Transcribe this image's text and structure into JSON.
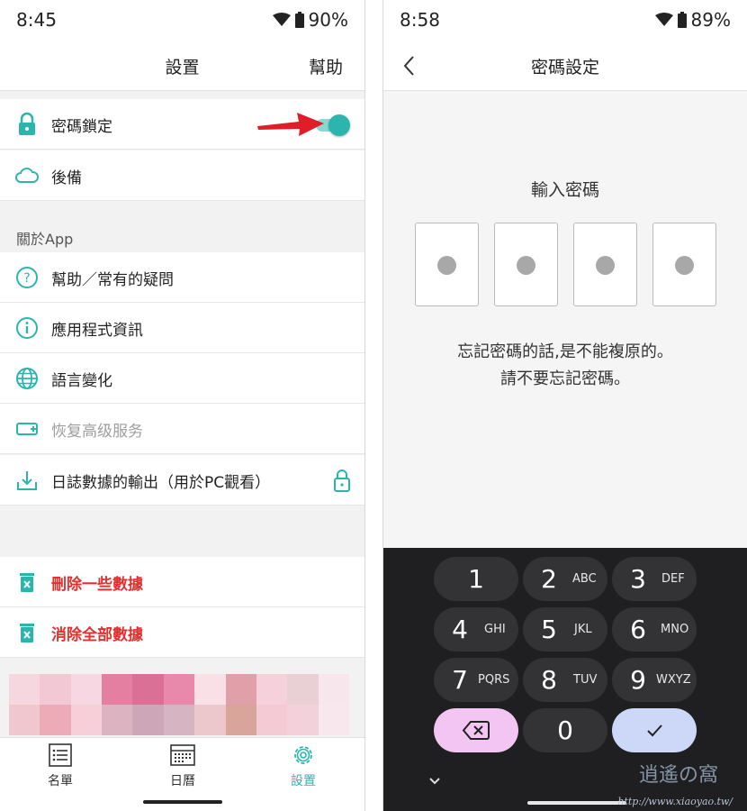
{
  "left": {
    "status": {
      "time": "8:45",
      "battery": "90%"
    },
    "header": {
      "title": "設置",
      "help": "幫助"
    },
    "rows": {
      "password_lock": "密碼鎖定",
      "backup": "後備",
      "about_section": "關於App",
      "help_faq": "幫助／常有的疑問",
      "app_info": "應用程式資訊",
      "language": "語言變化",
      "restore_premium": "恢复高级服务",
      "export_log": "日誌數據的輸出（用於PC觀看）",
      "delete_some": "刪除一些數據",
      "delete_all": "消除全部數據"
    },
    "toggle_on": true,
    "bottom_nav": {
      "list": "名單",
      "calendar": "日曆",
      "settings": "設置"
    }
  },
  "right": {
    "status": {
      "time": "8:58",
      "battery": "89%"
    },
    "header": {
      "title": "密碼設定"
    },
    "pin_label": "輸入密碼",
    "warning_line1": "忘記密碼的話,是不能複原的。",
    "warning_line2": "請不要忘記密碼。",
    "keypad": [
      {
        "digit": "1",
        "letters": ""
      },
      {
        "digit": "2",
        "letters": "ABC"
      },
      {
        "digit": "3",
        "letters": "DEF"
      },
      {
        "digit": "4",
        "letters": "GHI"
      },
      {
        "digit": "5",
        "letters": "JKL"
      },
      {
        "digit": "6",
        "letters": "MNO"
      },
      {
        "digit": "7",
        "letters": "PQRS"
      },
      {
        "digit": "8",
        "letters": "TUV"
      },
      {
        "digit": "9",
        "letters": "WXYZ"
      },
      {
        "digit": "0",
        "letters": ""
      }
    ],
    "watermark": "http://www.xiaoyao.tw/"
  },
  "colors": {
    "accent": "#2bb5ad",
    "danger": "#e0312f",
    "arrow": "#e11d27",
    "keyboard_bg": "#1f1f21"
  }
}
